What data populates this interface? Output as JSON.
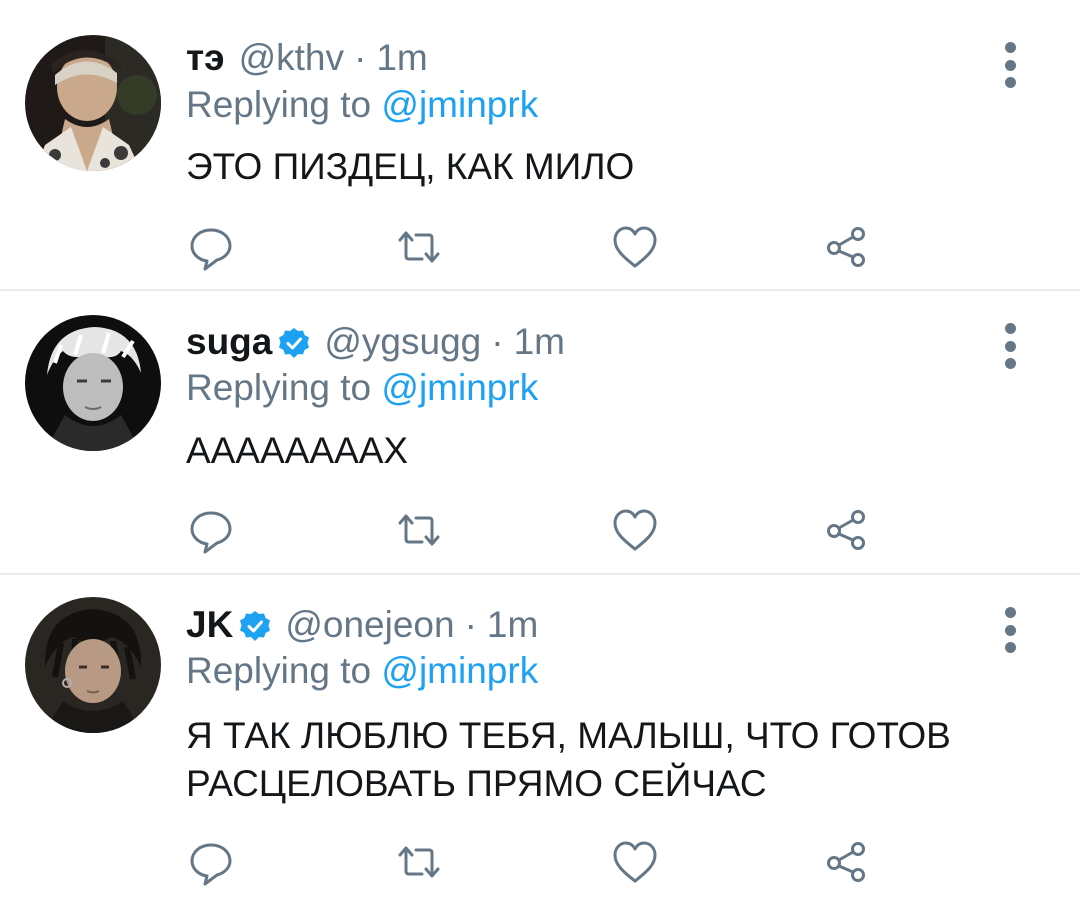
{
  "tweets": [
    {
      "name": "тэ",
      "verified": false,
      "handle": "@kthv",
      "separator": "·",
      "time": "1m",
      "replying_prefix": "Replying to",
      "replying_to": "@jminprk",
      "text": "ЭТО ПИЗДЕЦ, КАК МИЛО",
      "avatar_icon": "avatar-photo"
    },
    {
      "name": "suga",
      "verified": true,
      "handle": "@ygsugg",
      "separator": "·",
      "time": "1m",
      "replying_prefix": "Replying to",
      "replying_to": "@jminprk",
      "text": "ААААААААХ",
      "avatar_icon": "avatar-photo"
    },
    {
      "name": "JK",
      "verified": true,
      "handle": "@onejeon",
      "separator": "·",
      "time": "1m",
      "replying_prefix": "Replying to",
      "replying_to": "@jminprk",
      "text": "Я ТАК ЛЮБЛЮ ТЕБЯ, МАЛЫШ, ЧТО ГОТОВ РАСЦЕЛОВАТЬ ПРЯМО СЕЙЧАС",
      "avatar_icon": "avatar-photo"
    }
  ],
  "icons": {
    "reply": "reply-icon",
    "retweet": "retweet-icon",
    "like": "like-icon",
    "share": "share-icon",
    "menu": "more-options-icon",
    "verified": "verified-badge-icon"
  },
  "colors": {
    "text": "#14171a",
    "muted": "#657786",
    "link": "#1da1f2",
    "divider": "#e6ecf0",
    "verified": "#1da1f2"
  }
}
